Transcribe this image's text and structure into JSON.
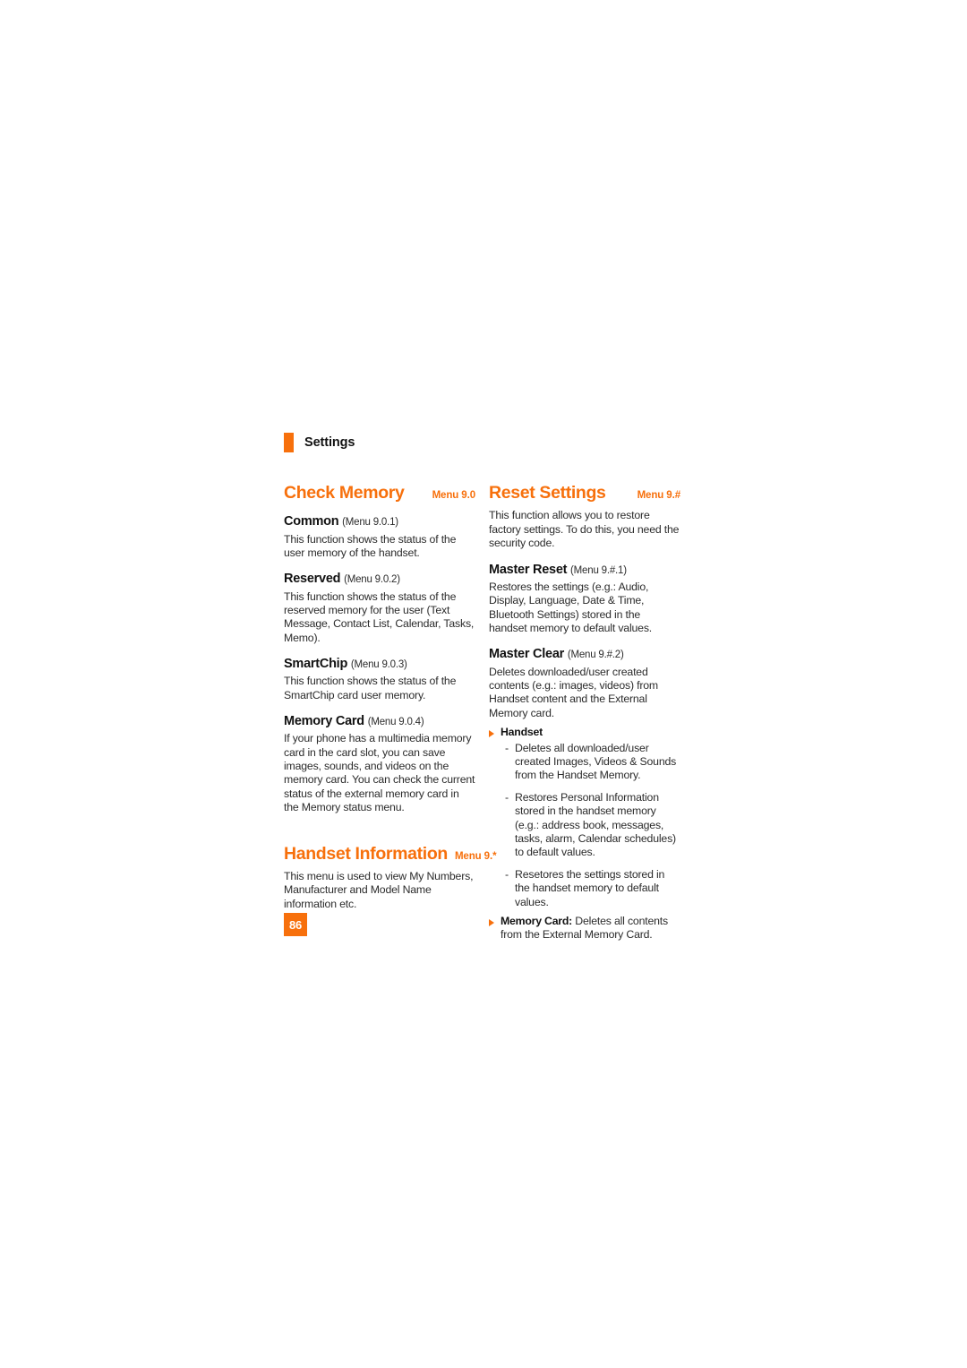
{
  "page": {
    "running_header": "Settings",
    "folio": "86"
  },
  "left_column": {
    "chapters": [
      {
        "title": "Check Memory",
        "menu": "Menu 9.0",
        "subsections": [
          {
            "heading": "Common",
            "ref": "(Menu 9.0.1)",
            "paragraph": "This function shows the status of the user memory of the handset."
          },
          {
            "heading": "Reserved",
            "ref": "(Menu 9.0.2)",
            "paragraph": "This function shows the status of the reserved memory for the user (Text Message, Contact List, Calendar, Tasks, Memo)."
          },
          {
            "heading": "SmartChip",
            "ref": "(Menu 9.0.3)",
            "paragraph": "This function shows the status of the SmartChip card user memory."
          },
          {
            "heading": "Memory Card",
            "ref": "(Menu 9.0.4)",
            "paragraph": "If your phone has a multimedia memory card in the card slot, you can save images, sounds, and videos on the memory card. You can check the current status of the external memory card in the Memory status menu."
          }
        ]
      },
      {
        "title": "Handset Information",
        "menu": "Menu 9.*",
        "intro": "This menu is used to view My Numbers, Manufacturer and Model Name information etc."
      }
    ]
  },
  "right_column": {
    "chapter": {
      "title": "Reset Settings",
      "menu": "Menu 9.#",
      "intro": "This function allows you to restore factory settings. To do this, you need the security code.",
      "subsections": [
        {
          "heading": "Master Reset",
          "ref": "(Menu 9.#.1)",
          "paragraph": "Restores the settings (e.g.: Audio, Display, Language, Date & Time, Bluetooth Settings) stored in the handset memory to default values."
        },
        {
          "heading": "Master Clear",
          "ref": "(Menu 9.#.2)",
          "paragraph": "Deletes downloaded/user created contents (e.g.: images, videos) from Handset content and the External Memory card."
        }
      ],
      "bullets": [
        {
          "label": "Handset",
          "text": "",
          "dashes": [
            "Deletes all downloaded/user created Images, Videos & Sounds from the Handset Memory.",
            "Restores Personal Information stored in the handset memory (e.g.: address book, messages, tasks, alarm, Calendar schedules) to default values.",
            "Resetores the settings stored in the handset memory to default values."
          ]
        },
        {
          "label": "Memory Card:",
          "text": " Deletes all contents from the External Memory Card.",
          "dashes": []
        }
      ],
      "dash_mark": "-"
    }
  },
  "colors": {
    "accent": "#F7700C",
    "body_text": "#2b2b2b",
    "heading_text": "#111111",
    "background": "#ffffff"
  }
}
